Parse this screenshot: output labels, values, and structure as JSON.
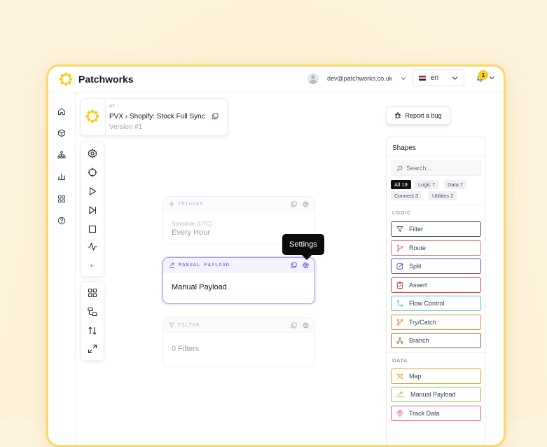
{
  "app": {
    "name": "Patchworks"
  },
  "topbar": {
    "email": "dev@patchworks.co.uk",
    "language": "en",
    "notifications": "1"
  },
  "flow": {
    "number": "#7",
    "title": "PVX › Shopify: Stock Full Sync",
    "version": "Version #1"
  },
  "canvas": {
    "nodes": [
      {
        "header": "TRIGGER",
        "sub": "Schedule (UTC)",
        "value": "Every Hour"
      },
      {
        "header": "MANUAL PAYLOAD",
        "value": "Manual Payload"
      },
      {
        "header": "FILTER",
        "value": "0 Filters"
      }
    ],
    "tooltip": "Settings"
  },
  "report_bug": "Report a bug",
  "shapes": {
    "title": "Shapes",
    "search_placeholder": "Search...",
    "chips": [
      "All 19",
      "Logic 7",
      "Data 7",
      "Connect 3",
      "Utilities 2"
    ],
    "logic_label": "LOGIC",
    "data_label": "DATA",
    "logic": [
      {
        "label": "Filter",
        "color": "#3f5566"
      },
      {
        "label": "Route",
        "color": "#e07b7b"
      },
      {
        "label": "Split",
        "color": "#5b4bd6"
      },
      {
        "label": "Assert",
        "color": "#d94141"
      },
      {
        "label": "Flow Control",
        "color": "#5cc7be"
      },
      {
        "label": "Try/Catch",
        "color": "#e28a2b"
      },
      {
        "label": "Branch",
        "color": "#8a6a3a"
      }
    ],
    "data": [
      {
        "label": "Map",
        "color": "#e0a21b"
      },
      {
        "label": "Manual Payload",
        "color": "#8cc34a"
      },
      {
        "label": "Track Data",
        "color": "#e05685"
      }
    ]
  },
  "colors": {
    "accent": "#facc15",
    "active_node": "#a99bf0",
    "window_border": "#fbd86a"
  }
}
